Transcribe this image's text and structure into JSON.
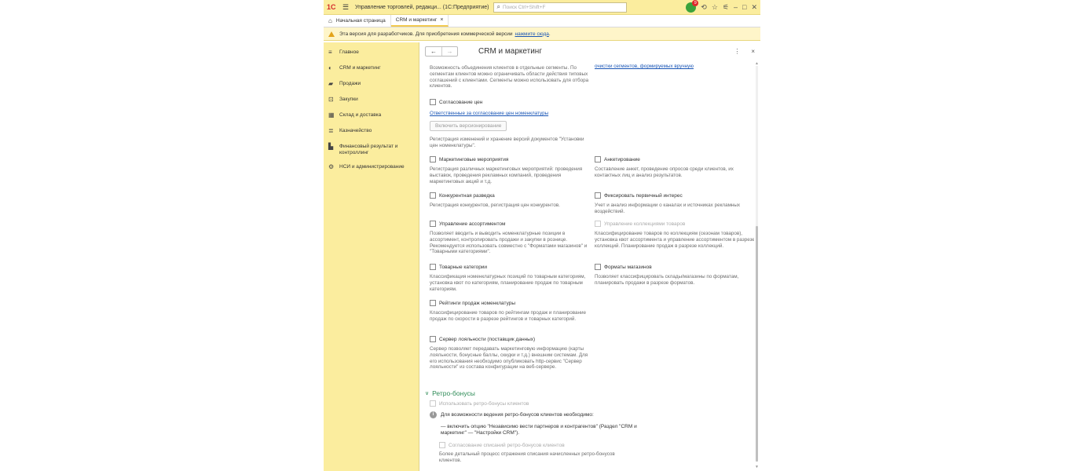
{
  "titlebar": {
    "logo": "1С",
    "title": "Управление торговлей, редакци... (1С:Предприятие)",
    "search_placeholder": "Поиск Ctrl+Shift+F",
    "notifications_count": "9"
  },
  "tabs": [
    {
      "label": "Начальная страница"
    },
    {
      "label": "CRM и маркетинг"
    }
  ],
  "warning": {
    "text": "Эта версия для разработчиков. Для приобретения коммерческой версии",
    "link": "нажмите сюда",
    "suffix": "."
  },
  "sidebar": {
    "items": [
      {
        "label": "Главное",
        "icon": "≡"
      },
      {
        "label": "CRM и маркетинг",
        "icon": "◐"
      },
      {
        "label": "Продажи",
        "icon": "▰"
      },
      {
        "label": "Закупки",
        "icon": "⊡"
      },
      {
        "label": "Склад и доставка",
        "icon": "▦"
      },
      {
        "label": "Казначейство",
        "icon": "≣"
      },
      {
        "label": "Финансовый результат и контроллинг",
        "icon": "▙"
      },
      {
        "label": "НСИ и администрирование",
        "icon": "⚙"
      }
    ]
  },
  "page": {
    "title": "CRM и маркетинг",
    "back": "←",
    "forward": "→",
    "more": "⋮",
    "close": "×"
  },
  "content": {
    "segments_desc": "Возможность объединения клиентов в отдельные сегменты. По сегментам клиентов можно ограничивать области действия типовых соглашений с клиентами. Сегменты можно использовать для отбора клиентов.",
    "segments_link_right": "очистки сегментов, формируемых вручную",
    "price_approval": "Согласование цен",
    "price_approval_link": "Ответственные за согласование цен номенклатуры",
    "versioning_button": "Включить версионирование",
    "versioning_desc": "Регистрация изменений и хранение версий документов \"Установки цен номенклатуры\".",
    "marketing_events": "Маркетинговые мероприятия",
    "marketing_events_desc": "Регистрация различных маркетинговых мероприятий: проведения выставок, проведения рекламных компаний, проведения маркетинговых акций и т.д.",
    "questionnaire": "Анкетирование",
    "questionnaire_desc": "Составление анкет, проведение опросов среди клиентов, их контактных лиц и анализ результатов.",
    "competitor": "Конкурентная разведка",
    "competitor_desc": "Регистрация конкурентов, регистрация цен конкурентов.",
    "primary_interest": "Фиксировать первичный интерес",
    "primary_interest_desc": "Учет и анализ информации о каналах и источниках рекламных воздействий.",
    "assortment": "Управление ассортиментом",
    "assortment_desc": "Позволяет вводить и выводить номенклатурные позиции в ассортимент, контролировать продажи и закупки в рознице. Рекомендуется использовать совместно с \"Форматами магазинов\" и \"Товарными категориями\".",
    "collections": "Управление коллекциями товаров",
    "collections_desc": "Классифицирование товаров по коллекциям (сезонам товаров), установка квот ассортимента и управление ассортиментом в разрезе коллекций. Планирование продаж в разрезе коллекций.",
    "categories": "Товарные категории",
    "categories_desc": "Классификация номенклатурных позиций по товарным категориям, установка квот по категориям, планирование продаж по товарным категориям.",
    "store_formats": "Форматы магазинов",
    "store_formats_desc": "Позволяет классифицировать склады/магазины по форматам, планировать продажи в разрезе форматов.",
    "ratings": "Рейтинги продаж номенклатуры",
    "ratings_desc": "Классифицирование товаров по рейтингам продаж и планирование продаж по скорости в разрезе рейтингов и товарных категорий.",
    "loyalty": "Сервер лояльности (поставщик данных)",
    "loyalty_desc": "Сервер позволяет передавать маркетинговую информацию (карты лояльности, бонусные баллы, скидки и т.д.) внешним системам. Для его использования необходимо опубликовать http-сервис \"Сервер лояльности\" из состава конфигурации на веб-сервере.",
    "retro_section": "Ретро-бонусы",
    "retro_use": "Использовать ретро-бонусы клиентов",
    "retro_info": "Для возможности ведения ретро-бонусов клиентов необходимо:",
    "retro_step": "— включить опцию \"Независимо вести партнеров и контрагентов\" (Раздел \"CRM и маркетинг\" — \"Настройки CRM\").",
    "retro_approval": "Согласование списаний ретро-бонусов клиентов",
    "retro_approval_desc": "Более детальный процесс отражения списания начисленных ретро-бонусов клиентов."
  }
}
